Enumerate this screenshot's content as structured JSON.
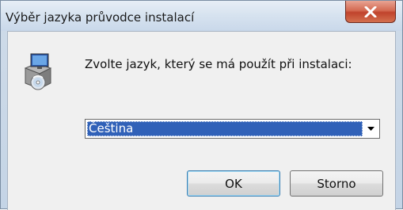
{
  "window": {
    "title": "Výběr jazyka průvodce instalací"
  },
  "dialog": {
    "icon": "setup-installer-icon",
    "prompt": "Zvolte jazyk, který se má použít při instalaci:",
    "language_select": {
      "selected": "Čeština"
    },
    "buttons": {
      "ok": "OK",
      "cancel": "Storno"
    }
  },
  "colors": {
    "selection": "#3061b8",
    "close_button": "#c0432c"
  }
}
